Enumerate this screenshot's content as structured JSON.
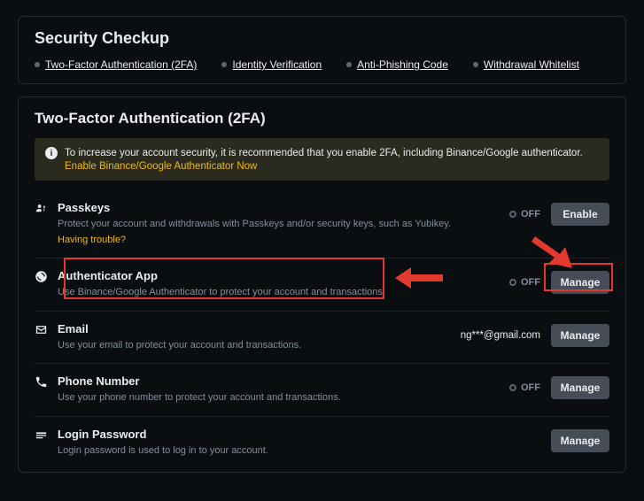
{
  "header": {
    "title": "Security Checkup",
    "tabs": [
      {
        "label": "Two-Factor Authentication (2FA)"
      },
      {
        "label": "Identity Verification"
      },
      {
        "label": "Anti-Phishing Code"
      },
      {
        "label": "Withdrawal Whitelist"
      }
    ]
  },
  "section": {
    "title": "Two-Factor Authentication (2FA)",
    "banner": {
      "text": "To increase your account security, it is recommended that you enable 2FA, including Binance/Google authenticator.",
      "link": "Enable Binance/Google Authenticator Now"
    },
    "items": {
      "passkeys": {
        "title": "Passkeys",
        "desc": "Protect your account and withdrawals with Passkeys and/or security keys, such as Yubikey.",
        "help": "Having trouble?",
        "status": "OFF",
        "button": "Enable"
      },
      "auth": {
        "title": "Authenticator App",
        "desc": "Use Binance/Google Authenticator to protect your account and transactions.",
        "status": "OFF",
        "button": "Manage"
      },
      "email": {
        "title": "Email",
        "desc": "Use your email to protect your account and transactions.",
        "value": "ng***@gmail.com",
        "button": "Manage"
      },
      "phone": {
        "title": "Phone Number",
        "desc": "Use your phone number to protect your account and transactions.",
        "status": "OFF",
        "button": "Manage"
      },
      "login": {
        "title": "Login Password",
        "desc": "Login password is used to log in to your account.",
        "button": "Manage"
      }
    }
  }
}
